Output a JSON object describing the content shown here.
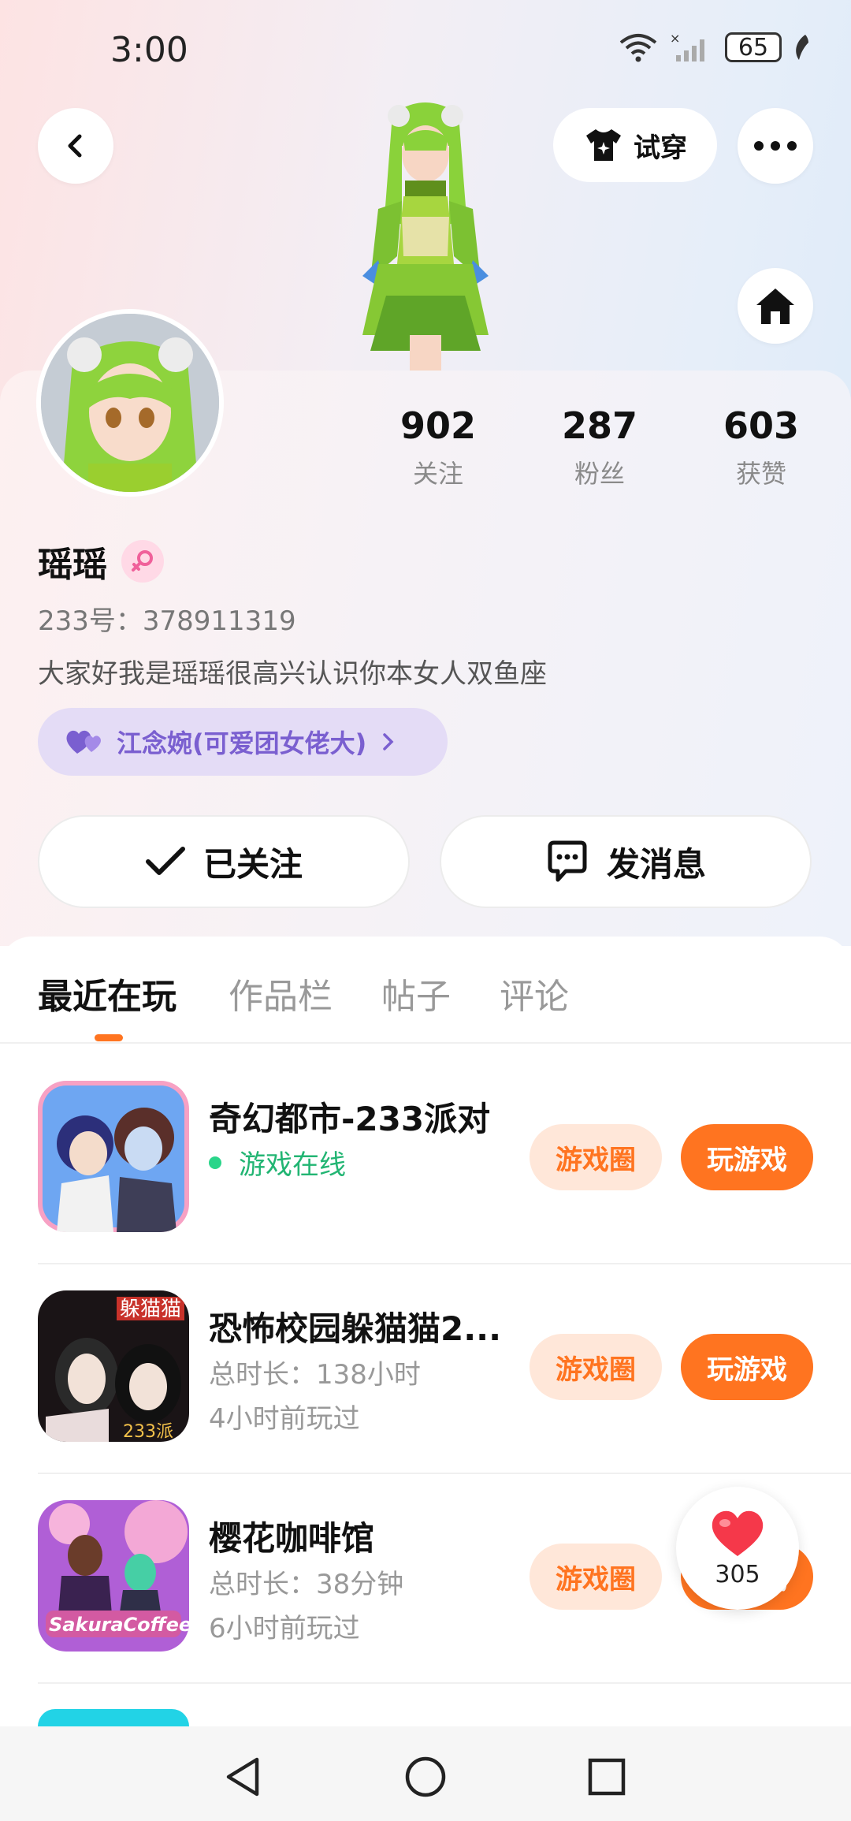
{
  "status_bar": {
    "time": "3:00",
    "battery": "65"
  },
  "header": {
    "try_on_label": "试穿"
  },
  "profile": {
    "stats": [
      {
        "value": "902",
        "label": "关注"
      },
      {
        "value": "287",
        "label": "粉丝"
      },
      {
        "value": "603",
        "label": "获赞"
      }
    ],
    "name": "瑶瑶",
    "uid": "233号：378911319",
    "bio": "大家好我是瑶瑶很高兴认识你本女人双鱼座",
    "cp_label": "江念婉(可爱团女佬大)"
  },
  "actions": {
    "follow_label": "已关注",
    "message_label": "发消息"
  },
  "tabs": [
    {
      "label": "最近在玩"
    },
    {
      "label": "作品栏"
    },
    {
      "label": "帖子"
    },
    {
      "label": "评论"
    }
  ],
  "games": [
    {
      "title": "奇幻都市-233派对",
      "status": "游戏在线",
      "circle_label": "游戏圈",
      "play_label": "玩游戏"
    },
    {
      "title": "恐怖校园躲猫猫2...",
      "duration": "总时长：138小时",
      "last_played": "4小时前玩过",
      "circle_label": "游戏圈",
      "play_label": "玩游戏"
    },
    {
      "title": "樱花咖啡馆",
      "duration": "总时长：38分钟",
      "last_played": "6小时前玩过",
      "circle_label": "游戏圈",
      "play_label": "玩游戏"
    }
  ],
  "floating_like": {
    "count": "305"
  },
  "colors": {
    "accent": "#ff7420",
    "online": "#22b573",
    "cp_purple": "#7a5fd0"
  }
}
